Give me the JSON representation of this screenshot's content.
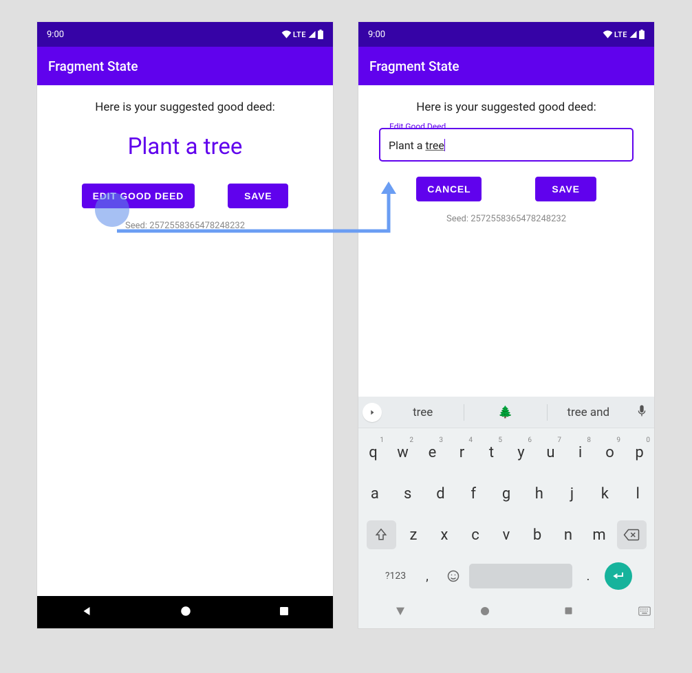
{
  "status": {
    "time": "9:00",
    "network": "LTE"
  },
  "app_bar": {
    "title": "Fragment State"
  },
  "screen_a": {
    "subtitle": "Here is your suggested good deed:",
    "deed": "Plant a tree",
    "edit_btn": "EDIT GOOD DEED",
    "save_btn": "SAVE",
    "seed": "Seed: 2572558365478248232"
  },
  "screen_b": {
    "subtitle": "Here is your suggested good deed:",
    "field_label": "Edit Good Deed",
    "field_value_prefix": "Plant a ",
    "field_value_underlined": "tree",
    "cancel_btn": "CANCEL",
    "save_btn": "SAVE",
    "seed": "Seed: 2572558365478248232"
  },
  "keyboard": {
    "suggestions": [
      "tree",
      "🌲",
      "tree and"
    ],
    "row1": [
      {
        "k": "q",
        "n": "1"
      },
      {
        "k": "w",
        "n": "2"
      },
      {
        "k": "e",
        "n": "3"
      },
      {
        "k": "r",
        "n": "4"
      },
      {
        "k": "t",
        "n": "5"
      },
      {
        "k": "y",
        "n": "6"
      },
      {
        "k": "u",
        "n": "7"
      },
      {
        "k": "i",
        "n": "8"
      },
      {
        "k": "o",
        "n": "9"
      },
      {
        "k": "p",
        "n": "0"
      }
    ],
    "row2": [
      "a",
      "s",
      "d",
      "f",
      "g",
      "h",
      "j",
      "k",
      "l"
    ],
    "row3": [
      "z",
      "x",
      "c",
      "v",
      "b",
      "n",
      "m"
    ],
    "symbols_key": "?123",
    "comma_key": ",",
    "period_key": "."
  }
}
